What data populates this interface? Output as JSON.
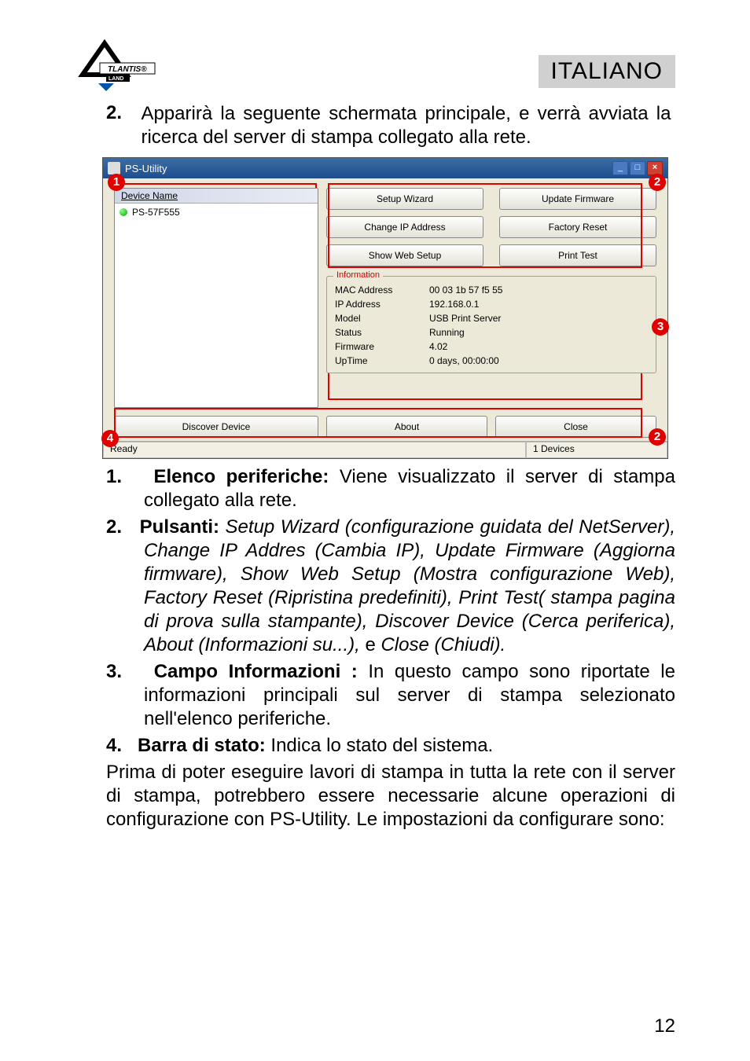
{
  "header": {
    "logo_text": "ATLANTIS",
    "logo_sub": "LAND",
    "lang": "ITALIANO"
  },
  "intro": {
    "num": "2.",
    "text": "Apparirà la seguente schermata principale, e verrà avviata la ricerca del server di stampa collegato alla rete."
  },
  "screenshot": {
    "title": "PS-Utility",
    "win_min": "_",
    "win_max": "□",
    "win_close": "×",
    "device_header": "Device Name",
    "device_item": "PS-57F555",
    "buttons": {
      "setup_wizard": "Setup Wizard",
      "update_firmware": "Update Firmware",
      "change_ip": "Change IP Address",
      "factory_reset": "Factory Reset",
      "show_web": "Show Web Setup",
      "print_test": "Print Test",
      "discover": "Discover Device",
      "about": "About",
      "close": "Close"
    },
    "info_title": "Information",
    "info": {
      "mac_label": "MAC Address",
      "mac_val": "00 03 1b 57 f5 55",
      "ip_label": "IP Address",
      "ip_val": "192.168.0.1",
      "model_label": "Model",
      "model_val": "USB Print Server",
      "status_label": "Status",
      "status_val": "Running",
      "fw_label": "Firmware",
      "fw_val": "4.02",
      "uptime_label": "UpTime",
      "uptime_val": "0 days, 00:00:00"
    },
    "status_left": "Ready",
    "status_right": "1 Devices",
    "anno": {
      "b1": "1",
      "b2a": "2",
      "b2b": "2",
      "b3": "3",
      "b4": "4"
    }
  },
  "list": {
    "i1_num": "1.",
    "i1_title": "Elenco periferiche:",
    "i1_text": " Viene visualizzato il server di stampa collegato alla rete.",
    "i2_num": "2.",
    "i2_title": "Pulsanti:",
    "i2_text_a": " Setup Wizard (configurazione guidata del NetServer), Change IP Addres (Cambia IP), Update Firmware (Aggiorna firmware), Show Web Setup (Mostra configurazione Web), Factory Reset (Ripristina predefiniti), Print Test( stampa pagina di prova sulla stampante), Discover Device (Cerca periferica), About (Informazioni su...),",
    "i2_text_b": " e ",
    "i2_text_c": "Close (Chiudi).",
    "i3_num": "3.",
    "i3_title": "Campo Informazioni :",
    "i3_text": " In questo campo sono riportate le informazioni principali sul server di stampa selezionato nell'elenco periferiche.",
    "i4_num": "4.",
    "i4_title": "Barra di stato:",
    "i4_text": " Indica lo stato del sistema."
  },
  "para": "Prima di poter eseguire lavori di stampa in tutta la rete con il server di stampa, potrebbero essere necessarie alcune operazioni di configurazione con PS-Utility.  Le impostazioni da configurare sono:",
  "page_num": "12"
}
